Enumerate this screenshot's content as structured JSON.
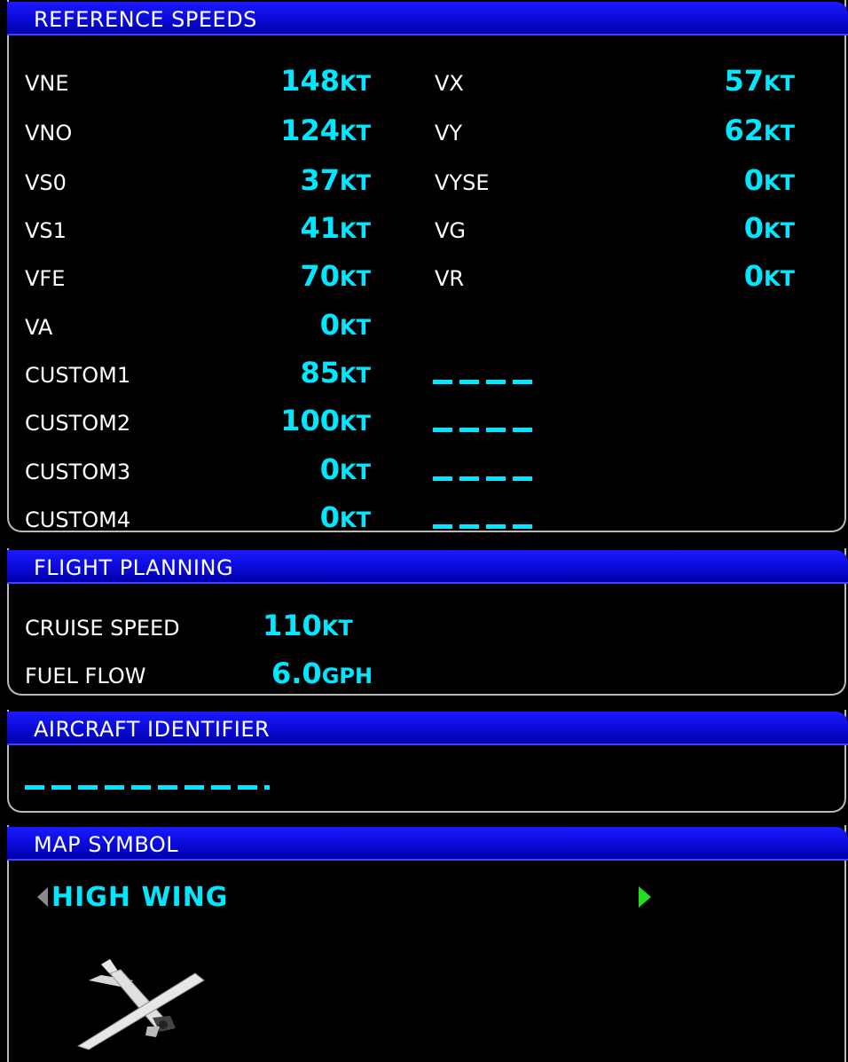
{
  "reference_speeds": {
    "title": "REFERENCE SPEEDS",
    "left": [
      {
        "label": "VNE",
        "value": "148",
        "unit": "KT"
      },
      {
        "label": "VNO",
        "value": "124",
        "unit": "KT"
      },
      {
        "label": "VS0",
        "value": "37",
        "unit": "KT"
      },
      {
        "label": "VS1",
        "value": "41",
        "unit": "KT"
      },
      {
        "label": "VFE",
        "value": "70",
        "unit": "KT"
      },
      {
        "label": "VA",
        "value": "0",
        "unit": "KT"
      },
      {
        "label": "CUSTOM1",
        "value": "85",
        "unit": "KT"
      },
      {
        "label": "CUSTOM2",
        "value": "100",
        "unit": "KT"
      },
      {
        "label": "CUSTOM3",
        "value": "0",
        "unit": "KT"
      },
      {
        "label": "CUSTOM4",
        "value": "0",
        "unit": "KT"
      }
    ],
    "right": [
      {
        "label": "VX",
        "value": "57",
        "unit": "KT"
      },
      {
        "label": "VY",
        "value": "62",
        "unit": "KT"
      },
      {
        "label": "VYSE",
        "value": "0",
        "unit": "KT"
      },
      {
        "label": "VG",
        "value": "0",
        "unit": "KT"
      },
      {
        "label": "VR",
        "value": "0",
        "unit": "KT"
      }
    ]
  },
  "flight_planning": {
    "title": "FLIGHT PLANNING",
    "cruise_speed_label": "CRUISE SPEED",
    "cruise_speed_value": "110",
    "cruise_speed_unit": "KT",
    "fuel_flow_label": "FUEL FLOW",
    "fuel_flow_value": "6.0",
    "fuel_flow_unit": "GPH"
  },
  "aircraft_identifier": {
    "title": "AIRCRAFT IDENTIFIER"
  },
  "map_symbol": {
    "title": "MAP SYMBOL",
    "selected": "HIGH WING"
  },
  "colors": {
    "value_cyan": "#00e8ff",
    "header_blue": "#0a0ad8",
    "arrow_green": "#22dd22"
  }
}
